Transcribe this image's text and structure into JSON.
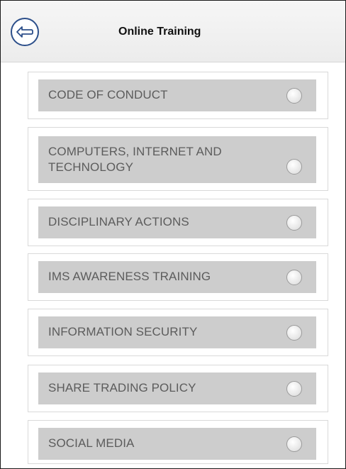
{
  "header": {
    "title": "Online Training",
    "back_icon": "back-arrow-icon"
  },
  "trainings": [
    {
      "label": "CODE OF CONDUCT"
    },
    {
      "label_line1": "COMPUTERS, INTERNET AND",
      "label_line2": "TECHNOLOGY"
    },
    {
      "label": "DISCIPLINARY ACTIONS"
    },
    {
      "label": "IMS AWARENESS TRAINING"
    },
    {
      "label": "INFORMATION SECURITY"
    },
    {
      "label": "SHARE TRADING POLICY"
    },
    {
      "label": "SOCIAL MEDIA"
    }
  ],
  "colors": {
    "item_background": "#cdcdcd",
    "item_text": "#5c5c5c",
    "back_button_border": "#2c4f8a"
  }
}
